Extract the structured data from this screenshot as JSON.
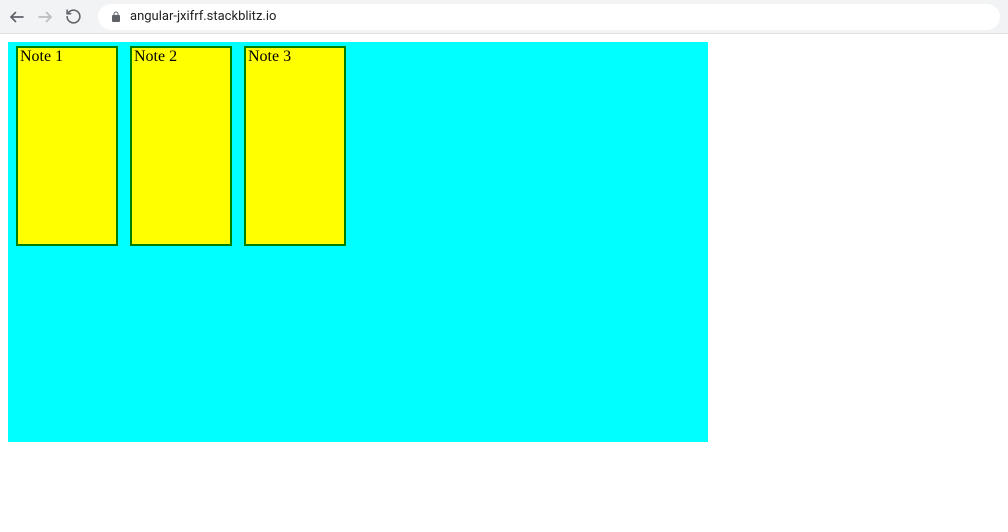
{
  "browser": {
    "url": "angular-jxifrf.stackblitz.io"
  },
  "board": {
    "notes": [
      {
        "label": "Note 1"
      },
      {
        "label": "Note 2"
      },
      {
        "label": "Note 3"
      }
    ]
  }
}
